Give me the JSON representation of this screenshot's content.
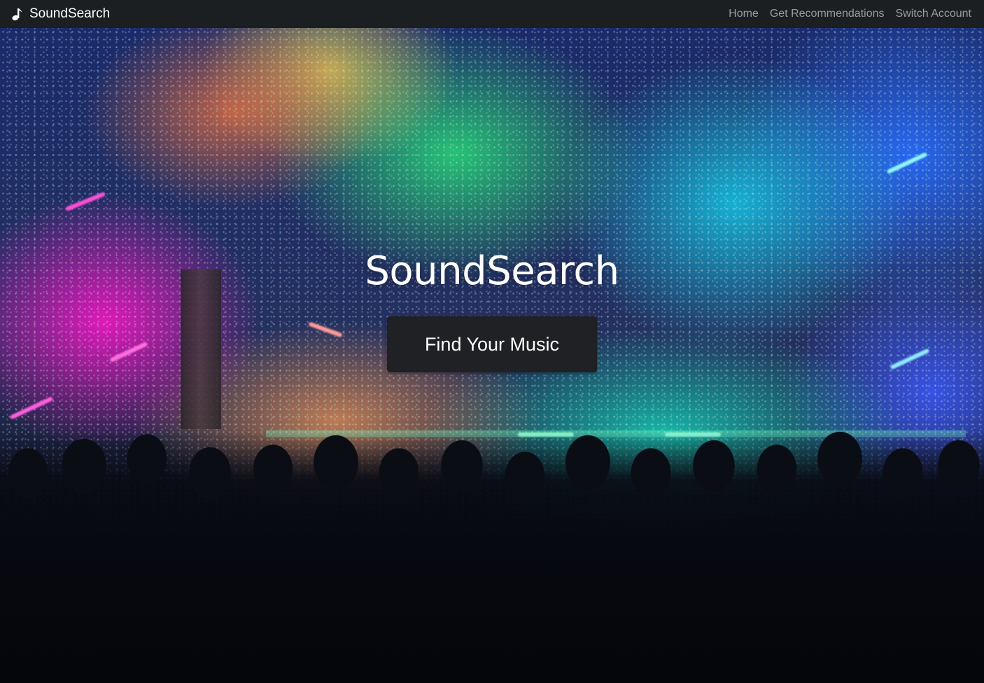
{
  "navbar": {
    "brand_icon": "music-note-icon",
    "brand": "SoundSearch",
    "links": [
      {
        "label": "Home"
      },
      {
        "label": "Get Recommendations"
      },
      {
        "label": "Switch Account"
      }
    ]
  },
  "hero": {
    "title": "SoundSearch",
    "cta_label": "Find Your Music",
    "background_image": "concert-crowd-stage-lights-confetti"
  },
  "colors": {
    "navbar_bg": "#1c1f22",
    "nav_link": "#9a9da1",
    "brand_text": "#ffffff",
    "button_bg": "#1f2124",
    "button_text": "#ffffff"
  }
}
